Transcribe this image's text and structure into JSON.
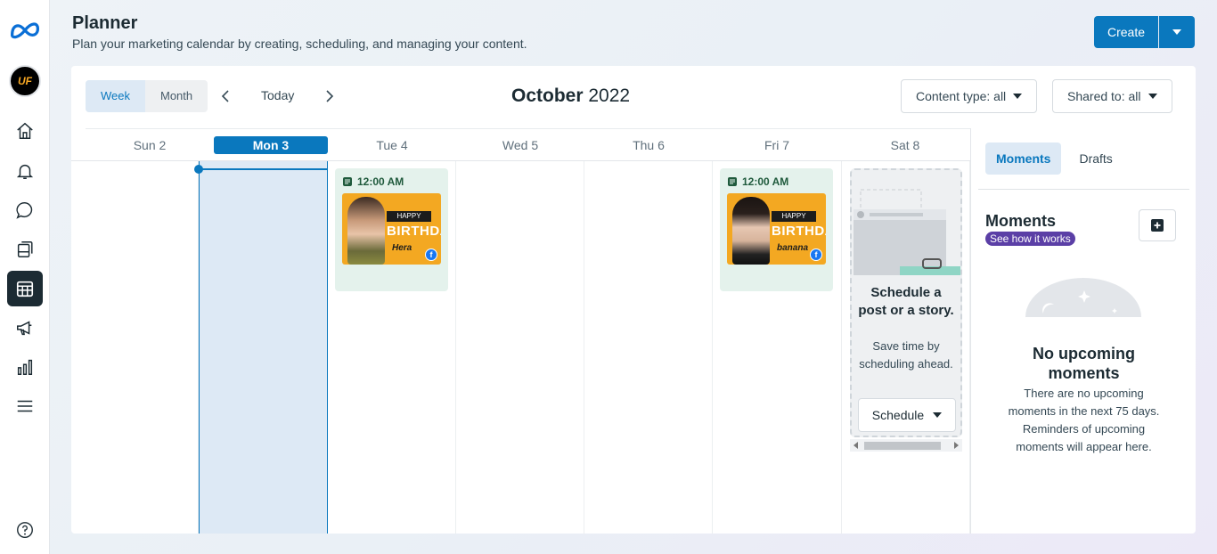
{
  "header": {
    "title": "Planner",
    "subtitle": "Plan your marketing calendar by creating, scheduling, and managing your content.",
    "create_label": "Create"
  },
  "nav": {
    "avatar_text": "UF",
    "icons": [
      "meta-logo-icon",
      "home-icon",
      "bell-icon",
      "chat-icon",
      "posts-icon",
      "calendar-icon",
      "megaphone-icon",
      "chart-icon",
      "menu-icon",
      "help-icon"
    ]
  },
  "toolbar": {
    "view_week": "Week",
    "view_month": "Month",
    "selected_view": "Week",
    "today": "Today",
    "month_name": "October",
    "year": "2022",
    "filter_content": "Content type: all",
    "filter_shared": "Shared to: all"
  },
  "days": [
    {
      "label": "Sun 2"
    },
    {
      "label": "Mon 3",
      "current": true
    },
    {
      "label": "Tue 4"
    },
    {
      "label": "Wed 5"
    },
    {
      "label": "Thu 6"
    },
    {
      "label": "Fri 7"
    },
    {
      "label": "Sat 8"
    }
  ],
  "posts": [
    {
      "day": "Tue 4",
      "time": "12:00 AM",
      "banner": "HAPPY",
      "headline": "BIRTHDA",
      "name": "Hera",
      "network": "facebook"
    },
    {
      "day": "Fri 7",
      "time": "12:00 AM",
      "banner": "HAPPY",
      "headline": "BIRTHDA",
      "name": "banana",
      "network": "facebook"
    }
  ],
  "schedule_tip": {
    "title": "Schedule a post or a story.",
    "body": "Save time by scheduling ahead.",
    "button": "Schedule"
  },
  "panel": {
    "tab_moments": "Moments",
    "tab_drafts": "Drafts",
    "selected_tab": "Moments",
    "section_title": "Moments",
    "link": "See how it works",
    "empty_title": "No upcoming moments",
    "empty_body": "There are no upcoming moments in the next 75 days. Reminders of upcoming moments will appear here."
  },
  "colors": {
    "accent": "#0a78be",
    "post_bg": "#e4f2ec",
    "link_badge": "#5b3fa6",
    "current_day_col": "#dde9f5"
  }
}
